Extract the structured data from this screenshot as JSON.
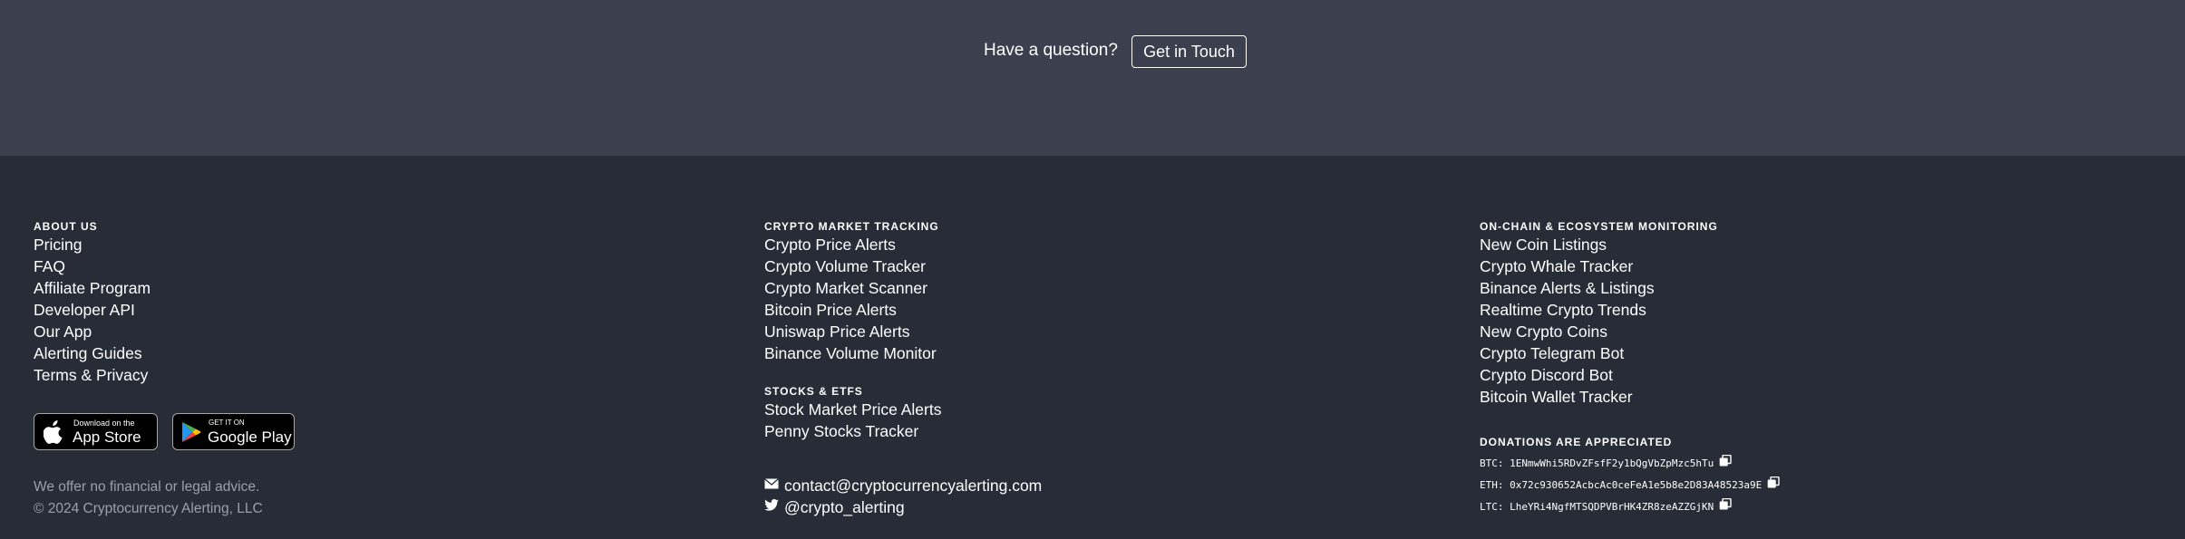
{
  "cta": {
    "question": "Have a question?",
    "button_label": "Get in Touch"
  },
  "footer": {
    "about": {
      "heading": "ABOUT US",
      "links": [
        "Pricing",
        "FAQ",
        "Affiliate Program",
        "Developer API",
        "Our App",
        "Alerting Guides",
        "Terms & Privacy"
      ]
    },
    "crypto_tracking": {
      "heading": "CRYPTO MARKET TRACKING",
      "links": [
        "Crypto Price Alerts",
        "Crypto Volume Tracker",
        "Crypto Market Scanner",
        "Bitcoin Price Alerts",
        "Uniswap Price Alerts",
        "Binance Volume Monitor"
      ]
    },
    "stocks": {
      "heading": "STOCKS & ETFS",
      "links": [
        "Stock Market Price Alerts",
        "Penny Stocks Tracker"
      ]
    },
    "onchain": {
      "heading": "ON-CHAIN & ECOSYSTEM MONITORING",
      "links": [
        "New Coin Listings",
        "Crypto Whale Tracker",
        "Binance Alerts & Listings",
        "Realtime Crypto Trends",
        "New Crypto Coins",
        "Crypto Telegram Bot",
        "Crypto Discord Bot",
        "Bitcoin Wallet Tracker"
      ]
    },
    "badges": {
      "apple_small": "Download on the",
      "apple_big": "App Store",
      "google_small": "GET IT ON",
      "google_big": "Google Play"
    },
    "disclaimer": "We offer no financial or legal advice.",
    "copyright": "© 2024 Cryptocurrency Alerting, LLC",
    "contact": {
      "email": "contact@cryptocurrencyalerting.com",
      "twitter": "@crypto_alerting"
    },
    "donations": {
      "heading": "DONATIONS ARE APPRECIATED",
      "btc": "BTC: 1ENmwWhi5RDvZFsfF2y1bQgVbZpMzc5hTu",
      "eth": "ETH: 0x72c930652AcbcAc0ceFeA1e5b8e2D83A48523a9E",
      "ltc": "LTC: LheYRi4NgfMTSQDPVBrHK4ZR8zeAZZGjKN"
    }
  }
}
